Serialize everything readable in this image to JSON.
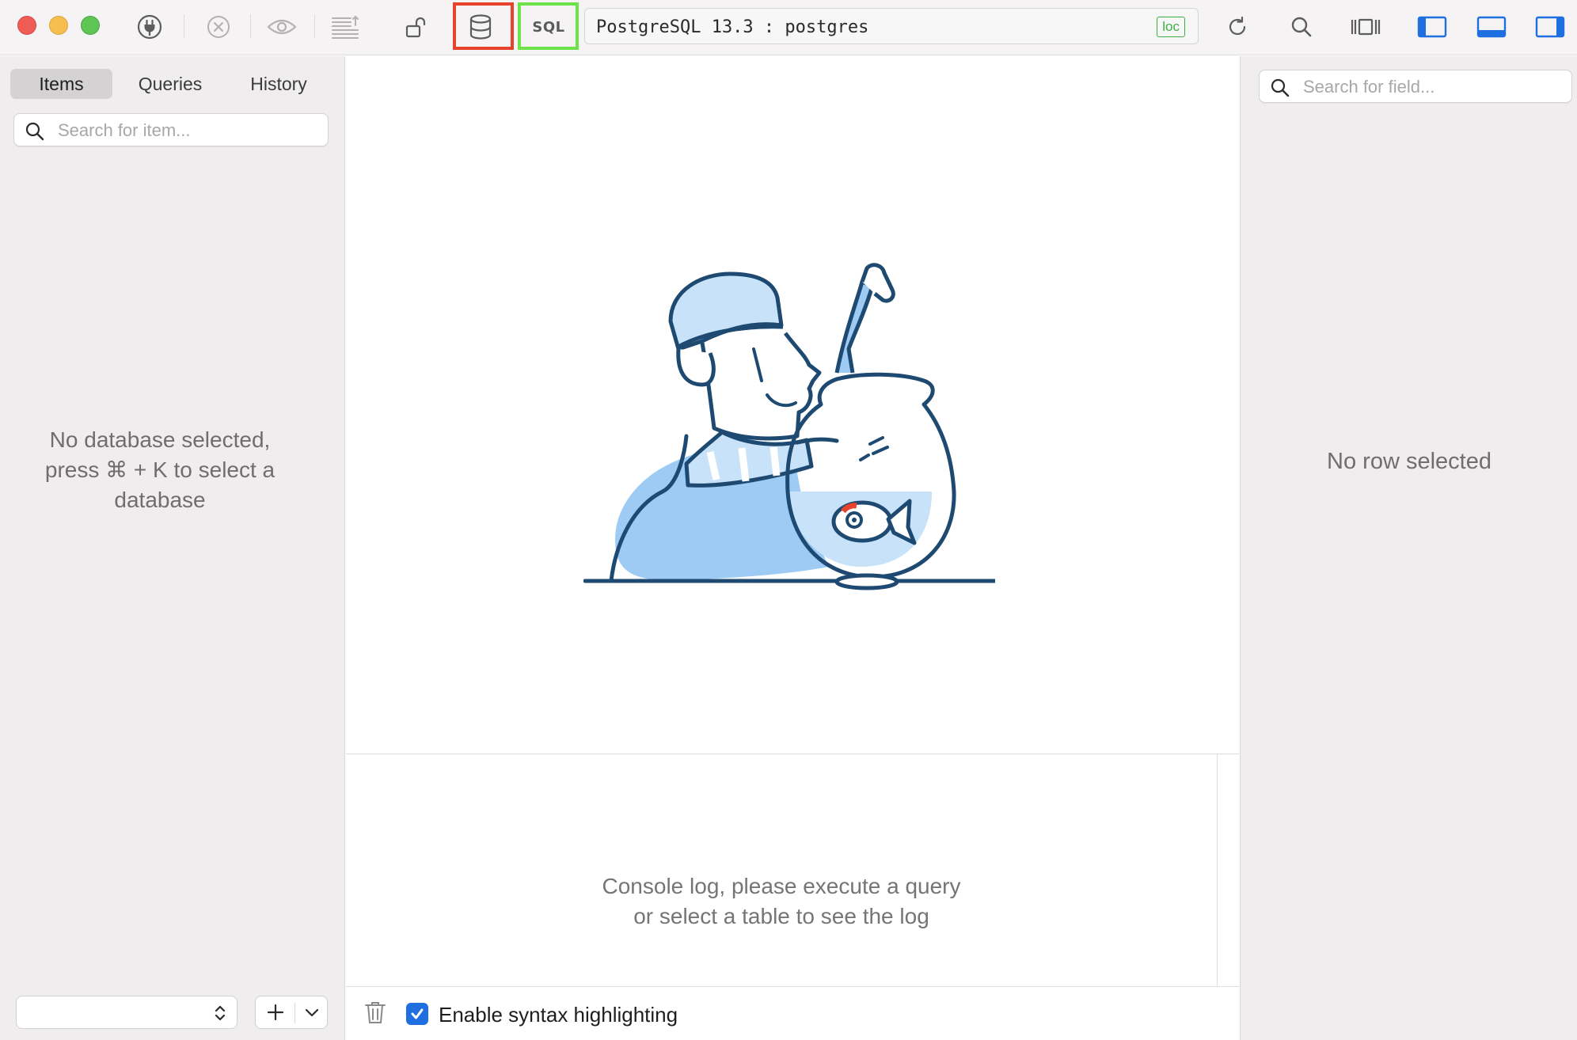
{
  "window": {
    "connection_label": "PostgreSQL 13.3 : postgres",
    "connection_badge": "loc",
    "sql_button_label": "SQL"
  },
  "toolbar": {
    "icons": [
      "connection-plug-icon",
      "close-circle-icon",
      "eye-icon",
      "text-align-icon",
      "unlock-icon",
      "database-icon",
      "sql-icon",
      "refresh-icon",
      "search-icon",
      "columns-icon",
      "left-panel-toggle-icon",
      "bottom-panel-toggle-icon",
      "right-panel-toggle-icon"
    ],
    "accent_color": "#1f6fe0",
    "highlight_red": "#e5432d",
    "highlight_green": "#6ee24b"
  },
  "sidebar": {
    "tabs": [
      {
        "label": "Items",
        "active": true
      },
      {
        "label": "Queries",
        "active": false
      },
      {
        "label": "History",
        "active": false
      }
    ],
    "search_placeholder": "Search for item...",
    "empty_message_line1": "No database selected,",
    "empty_message_line2": "press ⌘ + K to select a",
    "empty_message_line3": "database"
  },
  "console": {
    "message_line1": "Console log, please execute a query",
    "message_line2": "or select a table to see the log",
    "syntax_highlight_label": "Enable syntax highlighting",
    "syntax_highlight_checked": true
  },
  "details": {
    "search_placeholder": "Search for field...",
    "empty_message": "No row selected"
  }
}
